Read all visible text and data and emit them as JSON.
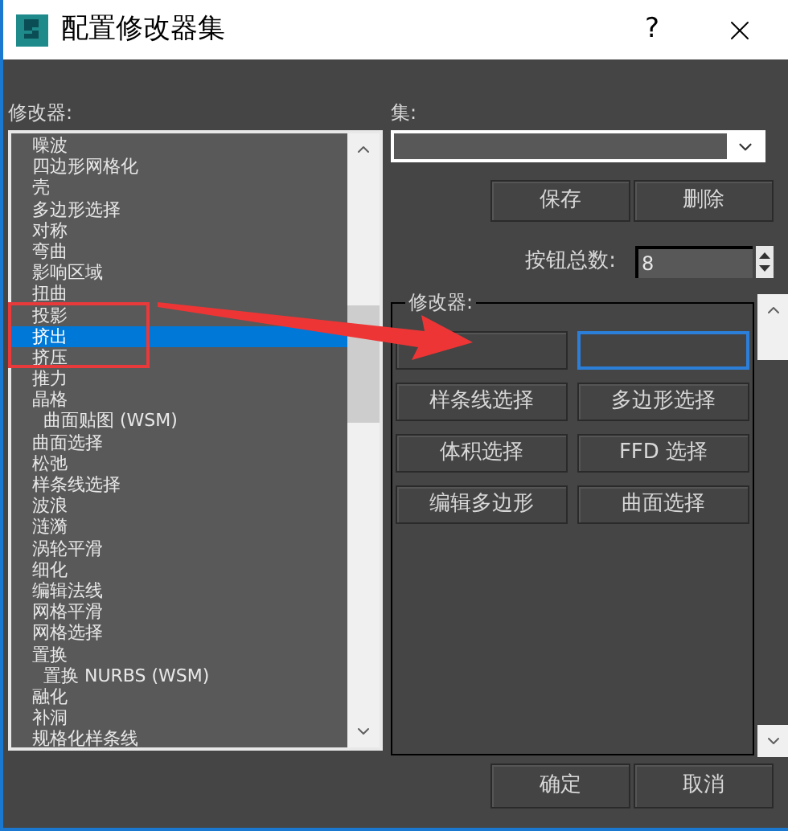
{
  "window": {
    "title": "配置修改器集",
    "help": "?"
  },
  "modifiers": {
    "label": "修改器:",
    "items": [
      {
        "label": "噪波",
        "selected": false
      },
      {
        "label": "四边形网格化",
        "selected": false
      },
      {
        "label": "壳",
        "selected": false
      },
      {
        "label": "多边形选择",
        "selected": false
      },
      {
        "label": "对称",
        "selected": false
      },
      {
        "label": "弯曲",
        "selected": false
      },
      {
        "label": "影响区域",
        "selected": false
      },
      {
        "label": "扭曲",
        "selected": false
      },
      {
        "label": "投影",
        "selected": false
      },
      {
        "label": "挤出",
        "selected": true
      },
      {
        "label": "挤压",
        "selected": false
      },
      {
        "label": "推力",
        "selected": false
      },
      {
        "label": "晶格",
        "selected": false,
        "children": [
          {
            "label": "曲面贴图 (WSM)",
            "selected": false
          }
        ]
      },
      {
        "label": "曲面选择",
        "selected": false
      },
      {
        "label": "松弛",
        "selected": false
      },
      {
        "label": "样条线选择",
        "selected": false
      },
      {
        "label": "波浪",
        "selected": false
      },
      {
        "label": "涟漪",
        "selected": false
      },
      {
        "label": "涡轮平滑",
        "selected": false
      },
      {
        "label": "细化",
        "selected": false
      },
      {
        "label": "编辑法线",
        "selected": false
      },
      {
        "label": "网格平滑",
        "selected": false
      },
      {
        "label": "网格选择",
        "selected": false
      },
      {
        "label": "置换",
        "selected": false,
        "children": [
          {
            "label": "置换 NURBS (WSM)",
            "selected": false
          }
        ]
      },
      {
        "label": "融化",
        "selected": false
      },
      {
        "label": "补洞",
        "selected": false
      },
      {
        "label": "规格化样条线",
        "selected": false
      }
    ]
  },
  "sets": {
    "label": "集:",
    "save": "保存",
    "delete": "删除",
    "count_label": "按钮总数:",
    "count": "8"
  },
  "modifier_buttons": {
    "label": "修改器:",
    "slots": [
      {
        "focused": false
      },
      {
        "focused": true
      },
      {
        "label": "样条线选择",
        "focused": false
      },
      {
        "label": "多边形选择",
        "focused": false
      },
      {
        "label": "体积选择",
        "focused": false
      },
      {
        "label": "FFD 选择",
        "focused": false
      },
      {
        "label": "编辑多边形",
        "focused": false
      },
      {
        "label": "曲面选择",
        "focused": false
      }
    ]
  },
  "buttons": {
    "ok": "确定",
    "cancel": "取消"
  }
}
